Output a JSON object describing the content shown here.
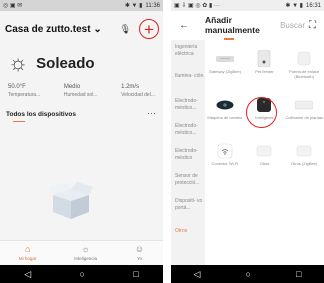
{
  "left": {
    "status_time": "11:36",
    "home_name": "Casa de zutto.test",
    "home_caret": "⌄",
    "weather": {
      "condition": "Soleado",
      "stats": [
        {
          "value": "50.0°F",
          "label": "Temperatura..."
        },
        {
          "value": "Medio",
          "label": "Humedad sol..."
        },
        {
          "value": "1.2m/s",
          "label": "Velocidad del..."
        }
      ]
    },
    "devices_title": "Todos los dispositivos",
    "devices_more": "···",
    "tabs": [
      {
        "label": "Mi hogar",
        "active": true
      },
      {
        "label": "Inteligencia",
        "active": false
      },
      {
        "label": "Yo",
        "active": false
      }
    ]
  },
  "right": {
    "status_time": "16:31",
    "tab_manual": "Añadir manualmente",
    "tab_scan": "Buscar",
    "categories": [
      "Ingeniería eléctrica",
      "Ilumina- ción",
      "Electrodo- méstico...",
      "Electrodo- méstico...",
      "Electrodo- méstico",
      "Sensor de protecció...",
      "Dispositi- vo portá...",
      "Otros"
    ],
    "devices": [
      {
        "label": "Gateway (ZigBee)",
        "icon": "gateway-icon"
      },
      {
        "label": "Pet feeder",
        "icon": "pet-feeder-icon"
      },
      {
        "label": "Puerta de enlace (Bluetooth)",
        "icon": "bluetooth-gateway-icon"
      },
      {
        "label": "Máquina de cambio",
        "icon": "robot-cleaner-icon"
      },
      {
        "label": "Inteligente",
        "icon": "smart-cube-icon"
      },
      {
        "label": "Cultivador de plantas",
        "icon": "plant-grower-icon"
      },
      {
        "label": "Conector Wi-Fi",
        "icon": "wifi-connector-icon"
      },
      {
        "label": "Otros",
        "icon": "others-icon"
      },
      {
        "label": "Otros (ZigBee)",
        "icon": "zigbee-others-icon"
      }
    ]
  },
  "colors": {
    "accent": "#e8663a",
    "highlight_ring": "#e02020"
  }
}
